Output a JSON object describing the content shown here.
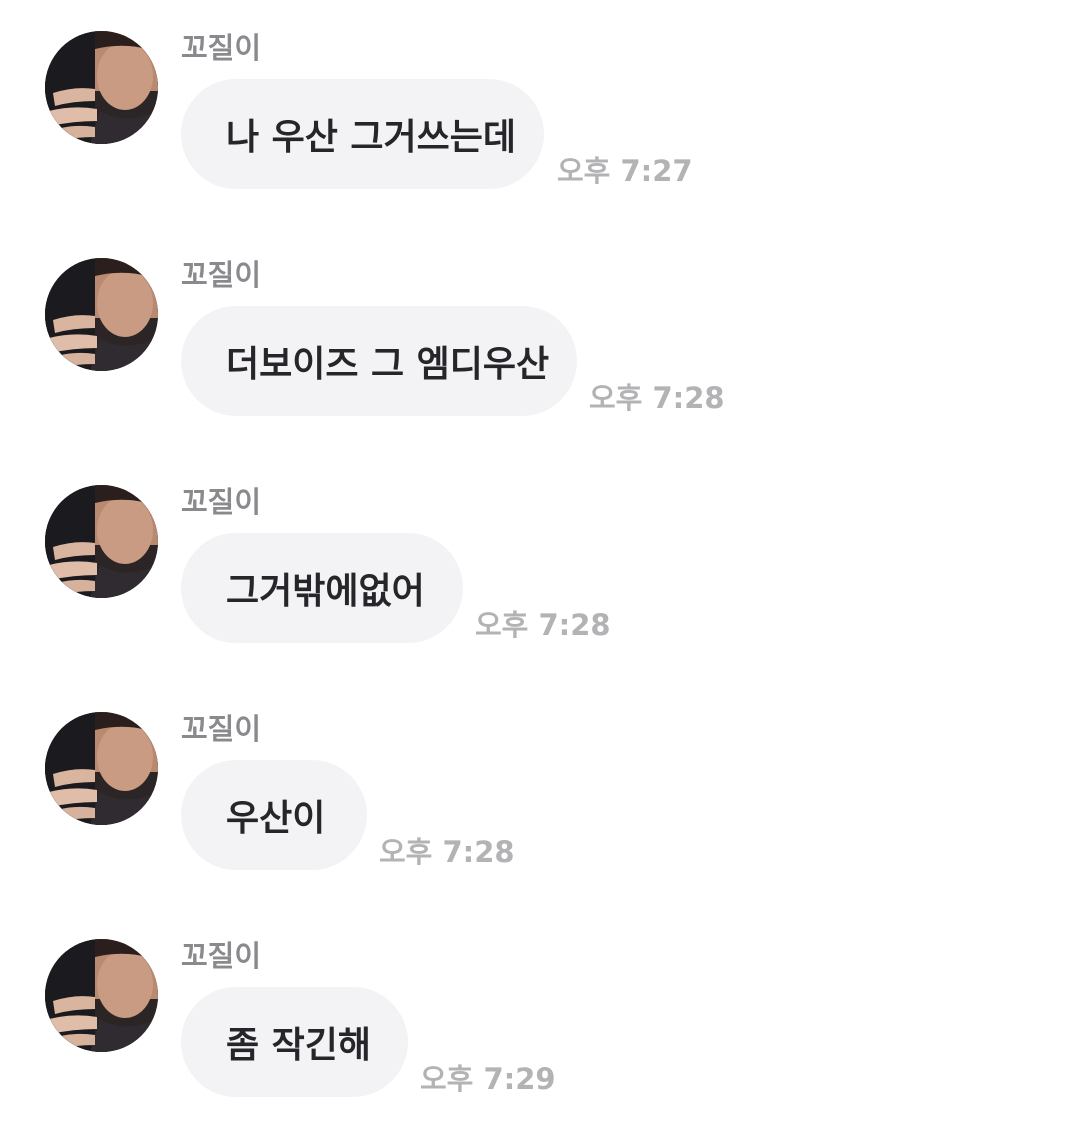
{
  "sender_name": "꼬질이",
  "avatar_icon": "profile-photo-avatar",
  "colors": {
    "bubble": "#f3f3f5",
    "sender": "#8a8a8e",
    "time": "#b3b3b6",
    "text": "#26262a"
  },
  "messages": [
    {
      "sender": "꼬질이",
      "text": "나 우산 그거쓰는데",
      "time": "오후 7:27"
    },
    {
      "sender": "꼬질이",
      "text": "더보이즈 그 엠디우산",
      "time": "오후 7:28"
    },
    {
      "sender": "꼬질이",
      "text": "그거밖에없어",
      "time": "오후 7:28"
    },
    {
      "sender": "꼬질이",
      "text": "우산이",
      "time": "오후 7:28"
    },
    {
      "sender": "꼬질이",
      "text": "좀 작긴해",
      "time": "오후 7:29"
    }
  ]
}
